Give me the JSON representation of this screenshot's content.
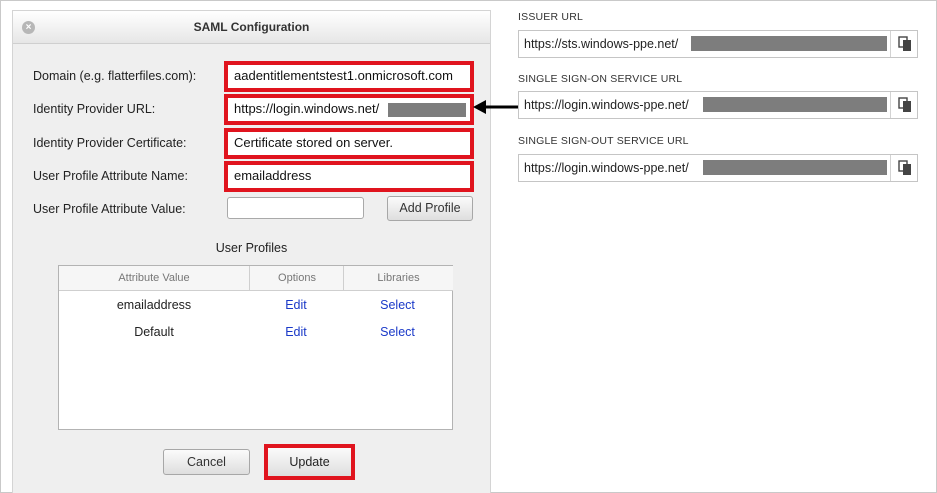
{
  "dialog": {
    "title": "SAML Configuration",
    "close_glyph": "×",
    "fields": {
      "domain_label": "Domain (e.g. flatterfiles.com):",
      "domain_value": "aadentitlementstest1.onmicrosoft.com",
      "idp_url_label": "Identity Provider URL:",
      "idp_url_value": "https://login.windows.net/",
      "idp_cert_label": "Identity Provider Certificate:",
      "idp_cert_value": "Certificate stored on server.",
      "attr_name_label": "User Profile Attribute Name:",
      "attr_name_value": "emailaddress",
      "attr_value_label": "User Profile Attribute Value:",
      "attr_value_value": ""
    },
    "add_profile_label": "Add Profile",
    "user_profiles": {
      "title": "User Profiles",
      "columns": [
        "Attribute Value",
        "Options",
        "Libraries"
      ],
      "rows": [
        {
          "attribute": "emailaddress",
          "option": "Edit",
          "library": "Select"
        },
        {
          "attribute": "Default",
          "option": "Edit",
          "library": "Select"
        }
      ]
    },
    "cancel_label": "Cancel",
    "update_label": "Update"
  },
  "right_panel": {
    "issuer": {
      "label": "ISSUER URL",
      "value": "https://sts.windows-ppe.net/"
    },
    "sso": {
      "label": "SINGLE SIGN-ON SERVICE URL",
      "value": "https://login.windows-ppe.net/"
    },
    "slo": {
      "label": "SINGLE SIGN-OUT SERVICE URL",
      "value": "https://login.windows-ppe.net/"
    }
  },
  "icons": [
    "close-icon",
    "copy-icon",
    "arrow-left-icon"
  ],
  "colors": {
    "highlight": "#e0141e",
    "link": "#1a39c8",
    "redaction": "#7d7d7d"
  }
}
